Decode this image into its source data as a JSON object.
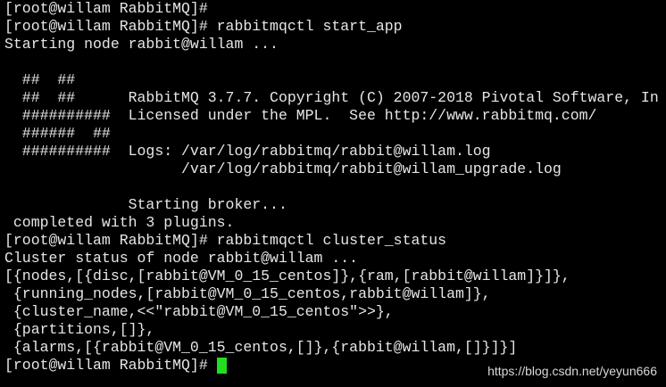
{
  "terminal": {
    "lines": [
      "[root@willam RabbitMQ]#",
      "[root@willam RabbitMQ]# rabbitmqctl start_app",
      "Starting node rabbit@willam ...",
      "",
      "  ##  ##",
      "  ##  ##      RabbitMQ 3.7.7. Copyright (C) 2007-2018 Pivotal Software, In",
      "  ##########  Licensed under the MPL.  See http://www.rabbitmq.com/",
      "  ######  ##",
      "  ##########  Logs: /var/log/rabbitmq/rabbit@willam.log",
      "                    /var/log/rabbitmq/rabbit@willam_upgrade.log",
      "",
      "              Starting broker...",
      " completed with 3 plugins.",
      "[root@willam RabbitMQ]# rabbitmqctl cluster_status",
      "Cluster status of node rabbit@willam ...",
      "[{nodes,[{disc,[rabbit@VM_0_15_centos]},{ram,[rabbit@willam]}]},",
      " {running_nodes,[rabbit@VM_0_15_centos,rabbit@willam]},",
      " {cluster_name,<<\"rabbit@VM_0_15_centos\">>},",
      " {partitions,[]},",
      " {alarms,[{rabbit@VM_0_15_centos,[]},{rabbit@willam,[]}]}]"
    ],
    "prompt": "[root@willam RabbitMQ]# ",
    "colors": {
      "background": "#000000",
      "text": "#e6e6e6",
      "cursor": "#22dd22"
    }
  },
  "watermark": "https://blog.csdn.net/yeyun666"
}
